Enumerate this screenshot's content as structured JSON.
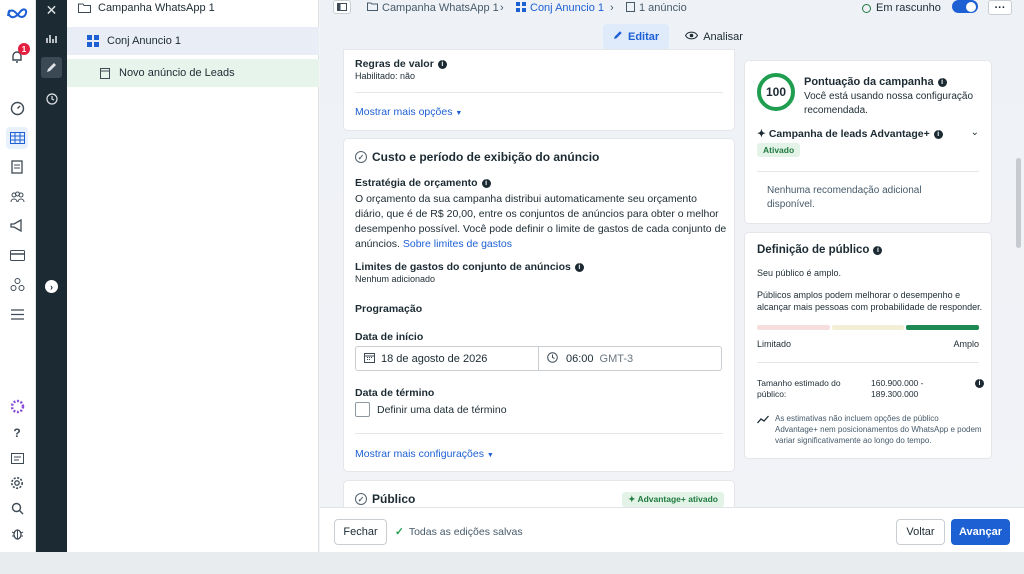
{
  "tree": {
    "campaign": "Campanha WhatsApp 1",
    "adset": "Conj Anuncio 1",
    "ad": "Novo anúncio de Leads"
  },
  "topbar": {
    "crumb_campaign": "Campanha WhatsApp 1",
    "crumb_adset": "Conj Anuncio 1",
    "crumb_ads": "1 anúncio",
    "status": "Em rascunho",
    "more": "···"
  },
  "toolbar": {
    "edit": "Editar",
    "analyze": "Analisar"
  },
  "rail": {
    "notification_count": "1"
  },
  "value_rules": {
    "title": "Regras de valor",
    "status": "Habilitado: não",
    "more": "Mostrar mais opções"
  },
  "budget": {
    "title": "Custo e período de exibição do anúncio",
    "strategy_label": "Estratégia de orçamento",
    "strategy_text": "O orçamento da sua campanha distribui automaticamente seu orçamento diário, que é de R$ 20,00, entre os conjuntos de anúncios para obter o melhor desempenho possível. Você pode definir o limite de gastos de cada conjunto de anúncios.",
    "strategy_link": "Sobre limites de gastos",
    "limits_label": "Limites de gastos do conjunto de anúncios",
    "limits_value": "Nenhum adicionado",
    "schedule_label": "Programação",
    "start_label": "Data de início",
    "start_date": "18 de agosto de 2026",
    "start_time": "06:00",
    "timezone": "GMT-3",
    "end_label": "Data de término",
    "end_checkbox": "Definir uma data de término",
    "more_settings": "Mostrar mais configurações"
  },
  "audience_section": {
    "title": "Público",
    "badge": "Advantage+ ativado"
  },
  "score": {
    "value": "100",
    "title": "Pontuação da campanha",
    "text": "Você está usando nossa configuração recomendada.",
    "advantage_title": "Campanha de leads Advantage+",
    "advantage_status": "Ativado",
    "no_rec": "Nenhuma recomendação adicional disponível."
  },
  "audience": {
    "title": "Definição de público",
    "line1": "Seu público é amplo.",
    "line2": "Públicos amplos podem melhorar o desempenho e alcançar mais pessoas com probabilidade de responder.",
    "min_label": "Limitado",
    "max_label": "Amplo",
    "breadth_fraction": 0.9,
    "size_label": "Tamanho estimado do público:",
    "size_value": "160.900.000 - 189.300.000",
    "note": "As estimativas não incluem opções de público Advantage+ nem posicionamentos do WhatsApp e podem variar significativamente ao longo do tempo."
  },
  "bottom": {
    "close": "Fechar",
    "saved": "Todas as edições salvas",
    "back": "Voltar",
    "next": "Avançar"
  },
  "colors": {
    "accent": "#1d60d4",
    "success": "#1f7a3f",
    "dark_rail": "#1c2b33"
  }
}
